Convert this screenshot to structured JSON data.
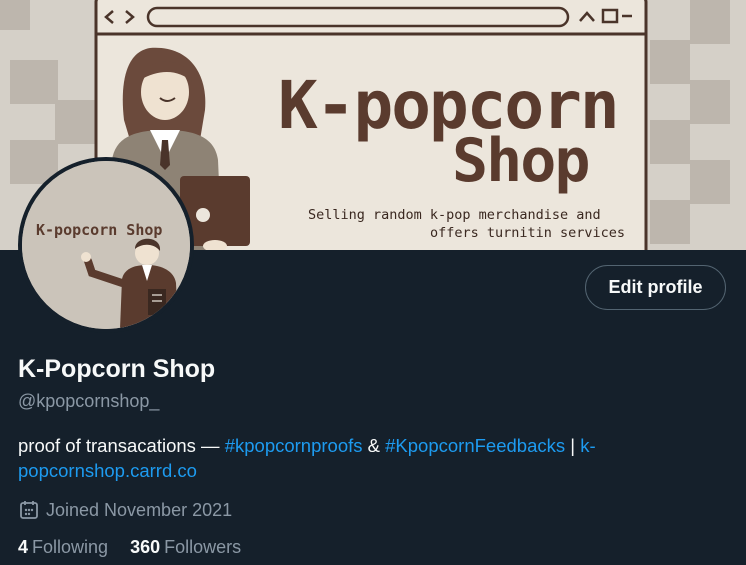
{
  "banner": {
    "shop_line1": "K-popcorn",
    "shop_line2": "Shop",
    "tagline1": "Selling random k-pop merchandise and",
    "tagline2": "offers turnitin services"
  },
  "avatar": {
    "label": "K-popcorn Shop"
  },
  "edit_profile_label": "Edit profile",
  "profile": {
    "name": "K-Popcorn Shop",
    "handle": "@kpopcornshop_"
  },
  "bio": {
    "text1": "proof of transacations — ",
    "hashtag1": "#kpopcornproofs",
    "text2": " & ",
    "hashtag2": "#KpopcornFeedbacks",
    "text3": " | ",
    "link": "k-popcornshop.carrd.co"
  },
  "joined": {
    "icon": "calendar-icon",
    "text": "Joined November 2021"
  },
  "stats": {
    "following_count": "4",
    "following_label": "Following",
    "followers_count": "360",
    "followers_label": "Followers"
  },
  "colors": {
    "background": "#15202b",
    "accent_link": "#1d9bf0",
    "secondary_text": "#8b98a5",
    "banner_bg": "#d5d0c8",
    "brand_brown": "#5a3b2e"
  }
}
